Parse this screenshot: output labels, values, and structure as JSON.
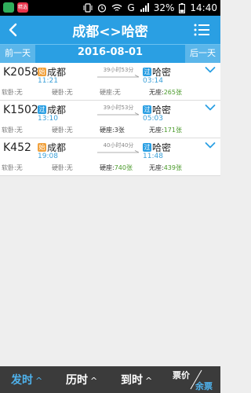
{
  "status_bar": {
    "battery": "32%",
    "time": "14:40",
    "network": "G",
    "app_badge": "精选"
  },
  "header": {
    "title": "成都<>哈密"
  },
  "date_bar": {
    "prev_day": "前一天",
    "date": "2016-08-01",
    "next_day": "后一天"
  },
  "trains": [
    {
      "number": "K2058",
      "from_badge": "始",
      "from_station": "成都",
      "depart_time": "11:21",
      "duration": "39小时53分",
      "to_badge": "过",
      "to_station": "哈密",
      "arrive_time": "03:14",
      "seat_soft": "软卧:无",
      "seat_hard_sleeper": "硬卧:无",
      "seat_hard_seat": "硬座:无",
      "seat_standing_label": "无座:",
      "seat_standing_count": "265张"
    },
    {
      "number": "K1502",
      "from_badge": "过",
      "from_station": "成都",
      "depart_time": "13:10",
      "duration": "39小时53分",
      "to_badge": "过",
      "to_station": "哈密",
      "arrive_time": "05:03",
      "seat_soft": "软卧:无",
      "seat_hard_sleeper": "硬卧:无",
      "seat_hard_seat": "硬座:3张",
      "seat_standing_label": "无座:",
      "seat_standing_count": "171张"
    },
    {
      "number": "K452",
      "from_badge": "始",
      "from_station": "成都",
      "depart_time": "19:08",
      "duration": "40小时40分",
      "to_badge": "过",
      "to_station": "哈密",
      "arrive_time": "11:48",
      "seat_soft": "软卧:无",
      "seat_hard_sleeper": "硬卧:无",
      "seat_hard_seat_label": "硬座:",
      "seat_hard_seat_count": "740张",
      "seat_standing_label": "无座:",
      "seat_standing_count": "439张"
    }
  ],
  "bottom_bar": {
    "sort_depart": "发时",
    "sort_duration": "历时",
    "sort_arrive": "到时",
    "fare": "票价",
    "remaining": "余票",
    "caret": "^"
  },
  "colors": {
    "primary": "#2a9fe3",
    "accent_orange": "#f0a03c",
    "seat_green": "#4a9a2a",
    "bottom_bar": "#3b3b3b"
  }
}
